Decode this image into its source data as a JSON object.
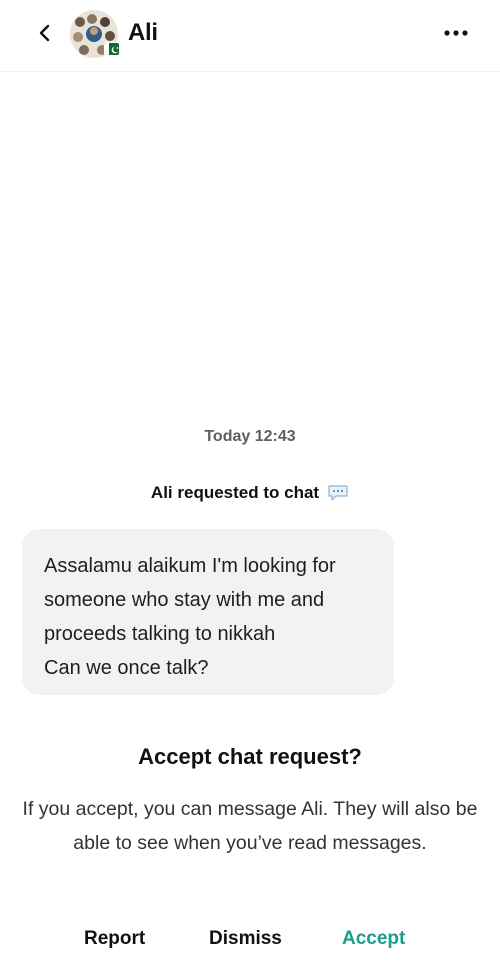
{
  "header": {
    "contact_name": "Ali",
    "back_icon": "chevron-left-icon",
    "more_icon": "more-horizontal-icon",
    "badge_icon": "pakistan-flag-icon"
  },
  "chat": {
    "timestamp": "Today 12:43",
    "system_message": "Ali requested to chat",
    "system_icon": "speech-bubble-icon",
    "message_lines": [
      "Assalamu alaikum I'm looking for",
      "someone who stay with me and",
      "proceeds talking to nikkah",
      "Can we once talk?"
    ]
  },
  "request": {
    "title": "Accept chat request?",
    "description": "If you accept, you can message Ali. They will also be able to see when you’ve read messages.",
    "report_label": "Report",
    "dismiss_label": "Dismiss",
    "accept_label": "Accept"
  },
  "colors": {
    "accent": "#1a9e8c",
    "bubble_bg": "#f2f2f2",
    "divider": "#efefef"
  }
}
